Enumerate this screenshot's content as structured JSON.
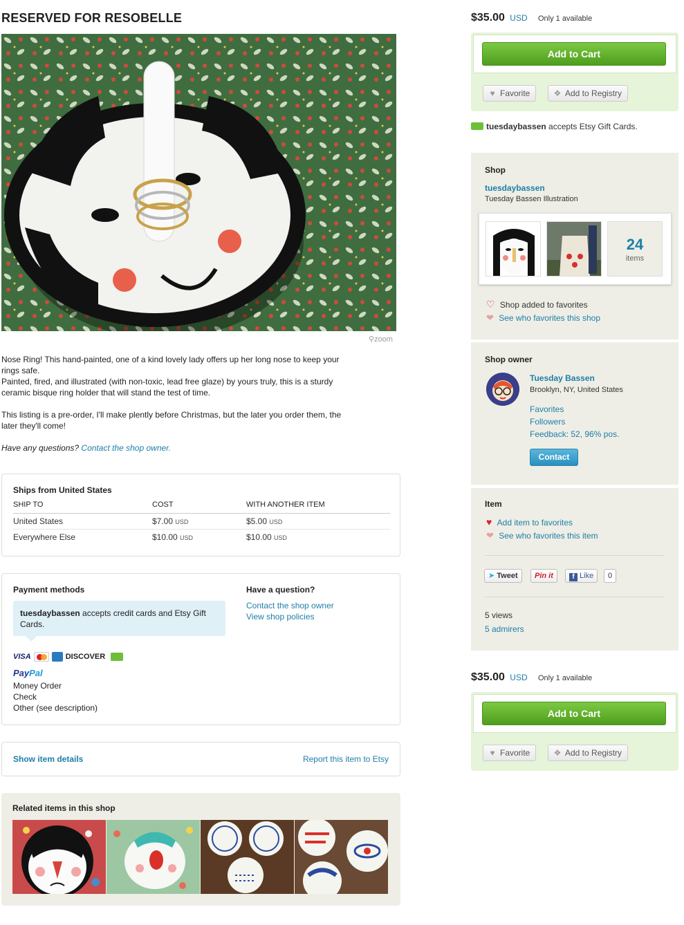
{
  "listing": {
    "title": "RESERVED FOR RESOBELLE",
    "zoom_label": "zoom",
    "description": [
      "Nose Ring! This hand-painted, one of a kind lovely lady offers up her long nose to keep your rings safe.",
      "Painted, fired, and illustrated (with non-toxic, lead free glaze) by yours truly, this is a sturdy ceramic bisque ring holder that will stand the test of time.",
      "This listing is a pre-order, I'll make plently before Christmas, but the later you order them, the later they'll come!"
    ],
    "question_prefix": "Have any questions?",
    "question_link": "Contact the shop owner."
  },
  "shipping": {
    "header": "Ships from United States",
    "columns": [
      "SHIP TO",
      "COST",
      "WITH ANOTHER ITEM"
    ],
    "rows": [
      {
        "to": "United States",
        "cost": "$7.00",
        "cost_cur": "USD",
        "another": "$5.00",
        "another_cur": "USD"
      },
      {
        "to": "Everywhere Else",
        "cost": "$10.00",
        "cost_cur": "USD",
        "another": "$10.00",
        "another_cur": "USD"
      }
    ]
  },
  "payment": {
    "header": "Payment methods",
    "shop": "tuesdaybassen",
    "accepts_text": " accepts credit cards and Etsy Gift Cards.",
    "cards": [
      "VISA",
      "MC",
      "AMEX",
      "DISCOVER"
    ],
    "paypal": {
      "a": "Pay",
      "b": "Pal"
    },
    "others": [
      "Money Order",
      "Check",
      "Other (see description)"
    ],
    "question_header": "Have a question?",
    "contact_link": "Contact the shop owner",
    "policies_link": "View shop policies"
  },
  "footer_links": {
    "details": "Show item details",
    "report": "Report this item to Etsy"
  },
  "related": {
    "header": "Related items in this shop"
  },
  "buy": {
    "price": "$35.00",
    "currency": "USD",
    "availability": "Only 1 available",
    "add_to_cart": "Add to Cart",
    "favorite": "Favorite",
    "registry": "Add to Registry"
  },
  "gift_cards": {
    "shop": "tuesdaybassen",
    "text": " accepts Etsy Gift Cards."
  },
  "shop": {
    "header": "Shop",
    "name": "tuesdaybassen",
    "subtitle": "Tuesday Bassen Illustration",
    "item_count": "24",
    "item_label": "items",
    "added_fav": "Shop added to favorites",
    "see_who": "See who favorites this shop"
  },
  "owner": {
    "header": "Shop owner",
    "name": "Tuesday Bassen",
    "location": "Brooklyn, NY, United States",
    "favorites": "Favorites",
    "followers": "Followers",
    "feedback": "Feedback: 52, 96% pos.",
    "contact": "Contact"
  },
  "item": {
    "header": "Item",
    "add_fav": "Add item to favorites",
    "see_who": "See who favorites this item",
    "tweet": "Tweet",
    "pin": "Pin it",
    "like": "Like",
    "like_count": "0",
    "views": "5 views",
    "admirers": "5 admirers"
  },
  "colors": {
    "accent_link": "#1e7ea7",
    "cart_green": "#5aab2a",
    "side_bg": "#eeeee6",
    "buy_bg": "#e6f4da"
  }
}
